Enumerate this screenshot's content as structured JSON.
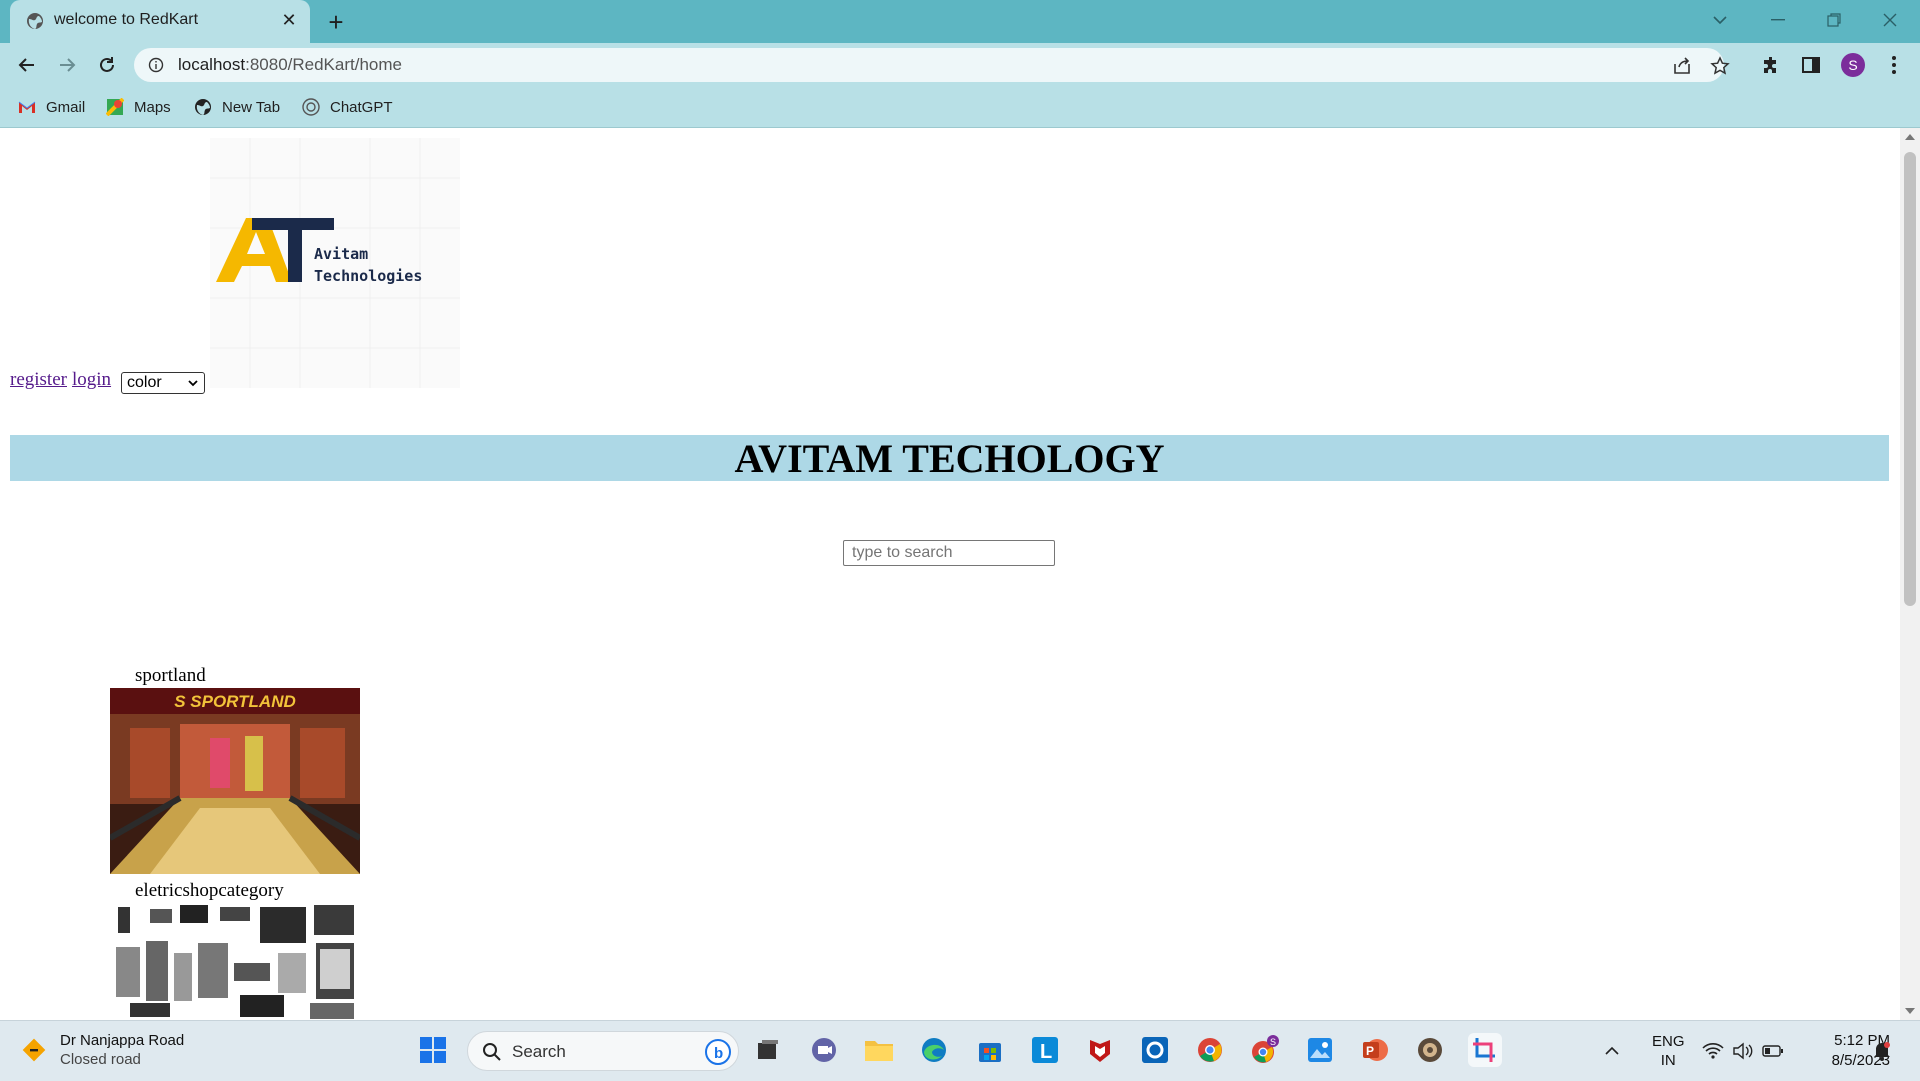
{
  "browser": {
    "tab_title": "welcome to RedKart",
    "url_host": "localhost",
    "url_path": ":8080/RedKart/home",
    "profile_initial": "S",
    "bookmarks": [
      {
        "label": "Gmail",
        "icon": "gmail-icon"
      },
      {
        "label": "Maps",
        "icon": "maps-icon"
      },
      {
        "label": "New Tab",
        "icon": "globe-icon"
      },
      {
        "label": "ChatGPT",
        "icon": "chatgpt-icon"
      }
    ]
  },
  "page": {
    "logo_text_line1": "Avitam",
    "logo_text_line2": "Technologies",
    "logo_letters": "AT",
    "links": {
      "register": "register",
      "login": "login"
    },
    "color_select": {
      "selected": "color"
    },
    "banner_title": "AVITAM TECHOLOGY",
    "search_placeholder": "type to search",
    "categories": [
      {
        "label": "sportland",
        "image": "sportland-store-photo"
      },
      {
        "label": "eletricshopcategory",
        "image": "electronics-collage-photo"
      }
    ]
  },
  "taskbar": {
    "weather_title": "Dr Nanjappa Road",
    "weather_sub": "Closed road",
    "search_label": "Search",
    "lang_line1": "ENG",
    "lang_line2": "IN",
    "time": "5:12 PM",
    "date": "8/5/2023",
    "chrome_badge": "S"
  },
  "colors": {
    "tabbar": "#5db6c2",
    "toolbar": "#b8e0e6",
    "banner": "#add8e6",
    "logo_yellow": "#f5b800",
    "logo_navy": "#1b2a4a"
  }
}
